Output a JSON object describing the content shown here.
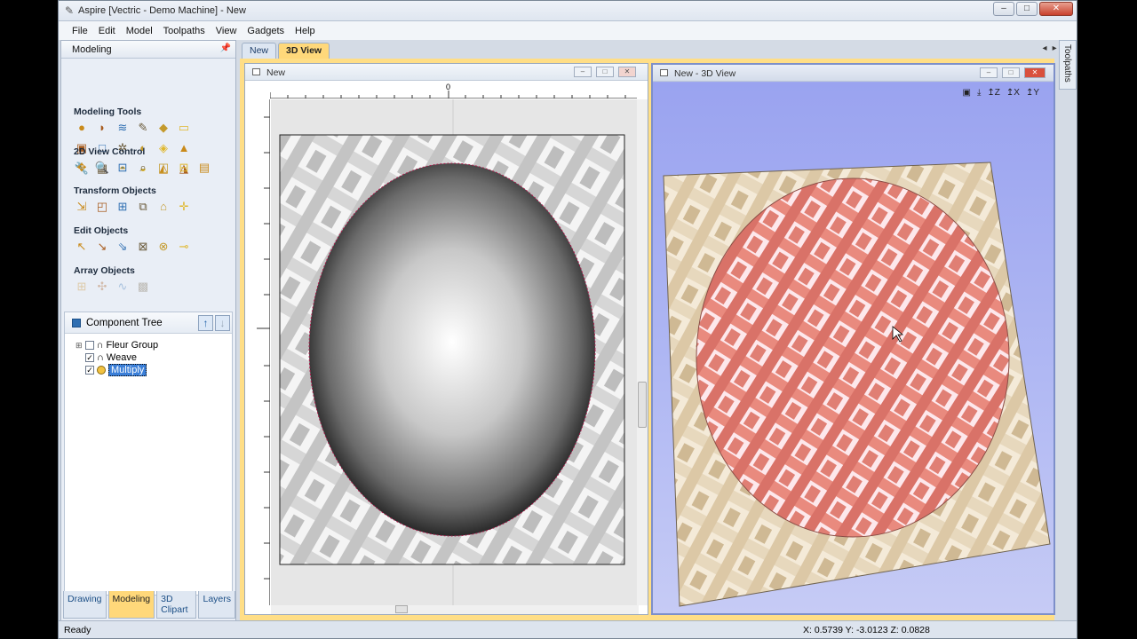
{
  "window": {
    "title": "Aspire [Vectric - Demo Machine] - New"
  },
  "menu": [
    "File",
    "Edit",
    "Model",
    "Toolpaths",
    "View",
    "Gadgets",
    "Help"
  ],
  "left_panel": {
    "title": "Modeling",
    "sections": [
      {
        "title": "Modeling Tools",
        "rows": [
          [
            "extrude-icon",
            "sweep-icon",
            "two-rail-icon",
            "sculpt-icon",
            "create-shape-icon",
            "import-component-icon"
          ],
          [
            "rectangle-component-icon",
            "vector-component-icon",
            "weave-icon",
            "scale-icon",
            "distort-icon",
            "bell-shape-icon"
          ],
          [
            "wrench-icon",
            "texture-icon",
            "dome-icon",
            "bake-icon",
            "slice-icon",
            "tilt-icon"
          ]
        ]
      },
      {
        "title": "2D View Control",
        "rows": [
          [
            "pan-icon",
            "zoom-icon",
            "zoom-to-fit-icon",
            "zoom-box-icon",
            "split-h-icon",
            "split-v-icon",
            "window-icon"
          ]
        ]
      },
      {
        "title": "Transform Objects",
        "rows": [
          [
            "move-icon",
            "size-icon",
            "align-icon",
            "mirror-icon",
            "node-icon",
            "rotate-icon"
          ]
        ]
      },
      {
        "title": "Edit Objects",
        "rows": [
          [
            "select-icon",
            "node-edit-icon",
            "interactive-select-icon",
            "group-icon",
            "ungroup-icon",
            "measure-icon"
          ]
        ]
      },
      {
        "title": "Array Objects",
        "rows": [
          [
            "grid-array-icon",
            "circular-array-icon",
            "path-copy-icon",
            "nest-icon"
          ]
        ]
      }
    ],
    "component_tree": {
      "title": "Component Tree",
      "items": [
        {
          "label": "Fleur Group",
          "checked": false,
          "expander": true
        },
        {
          "label": "Weave",
          "checked": true,
          "expander": false
        },
        {
          "label": "Multiply",
          "checked": true,
          "expander": false,
          "selected": true
        }
      ]
    },
    "bottom_tabs": [
      "Drawing",
      "Modeling",
      "3D Clipart",
      "Layers"
    ],
    "active_tab": "Modeling"
  },
  "doc_tabs": [
    "New",
    "3D View"
  ],
  "active_doc_tab": "3D View",
  "views": {
    "view2d_title": "New",
    "view3d_title": "New - 3D View",
    "ruler_zero": "0"
  },
  "right_tab": "Toolpaths",
  "status": {
    "left": "Ready",
    "coords": "X: 0.5739 Y: -3.0123 Z: 0.0828"
  },
  "colors": {
    "accent_tab": "#ffd87a",
    "weave_3d": "#e98a7e",
    "background_weave": "#e7d8bd",
    "view3d_bg": "#a9b1f2"
  }
}
